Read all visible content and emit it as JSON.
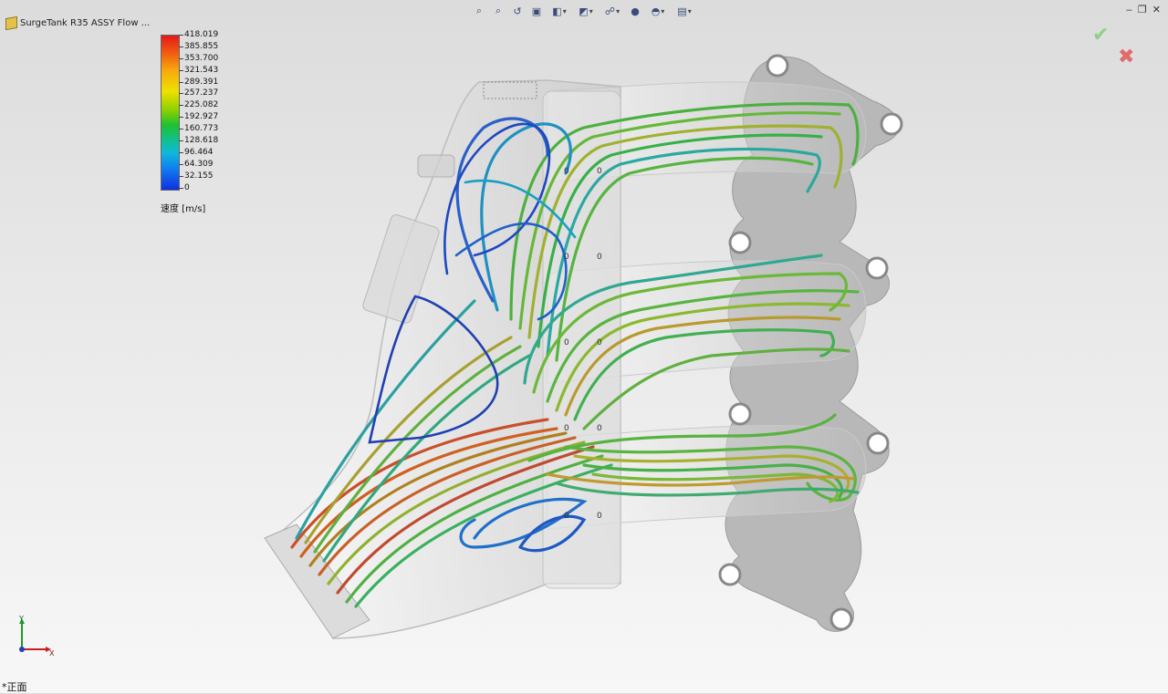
{
  "model": {
    "title": "SurgeTank R35 ASSY Flow ...",
    "icon": "assembly-cube-icon"
  },
  "toolbar": {
    "items": [
      {
        "icon": "zoom-to-fit-icon",
        "glyph": "⌕"
      },
      {
        "icon": "zoom-to-area-icon",
        "glyph": "⌕"
      },
      {
        "icon": "previous-view-icon",
        "glyph": "↺"
      },
      {
        "icon": "section-view-icon",
        "glyph": "▣"
      },
      {
        "icon": "view-orientation-icon",
        "glyph": "◧"
      },
      {
        "icon": "display-style-icon",
        "glyph": "◩"
      },
      {
        "icon": "hide-show-items-icon",
        "glyph": "☍"
      },
      {
        "icon": "edit-appearance-icon",
        "glyph": "●"
      },
      {
        "icon": "apply-scene-icon",
        "glyph": "◓"
      },
      {
        "icon": "view-settings-icon",
        "glyph": "▤"
      }
    ]
  },
  "window_controls": {
    "minimize": "‒",
    "restore": "❐",
    "close": "✕"
  },
  "confirm": {
    "ok": "✔",
    "cancel": "✖"
  },
  "legend": {
    "labels": [
      "418.019",
      "385.855",
      "353.700",
      "321.543",
      "289.391",
      "257.237",
      "225.082",
      "192.927",
      "160.773",
      "128.618",
      "96.464",
      "64.309",
      "32.155",
      "0"
    ],
    "unit": "速度 [m/s]",
    "colors": [
      "#e41a1a",
      "#f06010",
      "#f7a50f",
      "#f0e000",
      "#8fd200",
      "#20c030",
      "#10c090",
      "#10b8d8",
      "#1080f0",
      "#1030e0"
    ]
  },
  "triad": {
    "y_label": "Y",
    "x_label": "X"
  },
  "view": {
    "label": "*正面"
  }
}
